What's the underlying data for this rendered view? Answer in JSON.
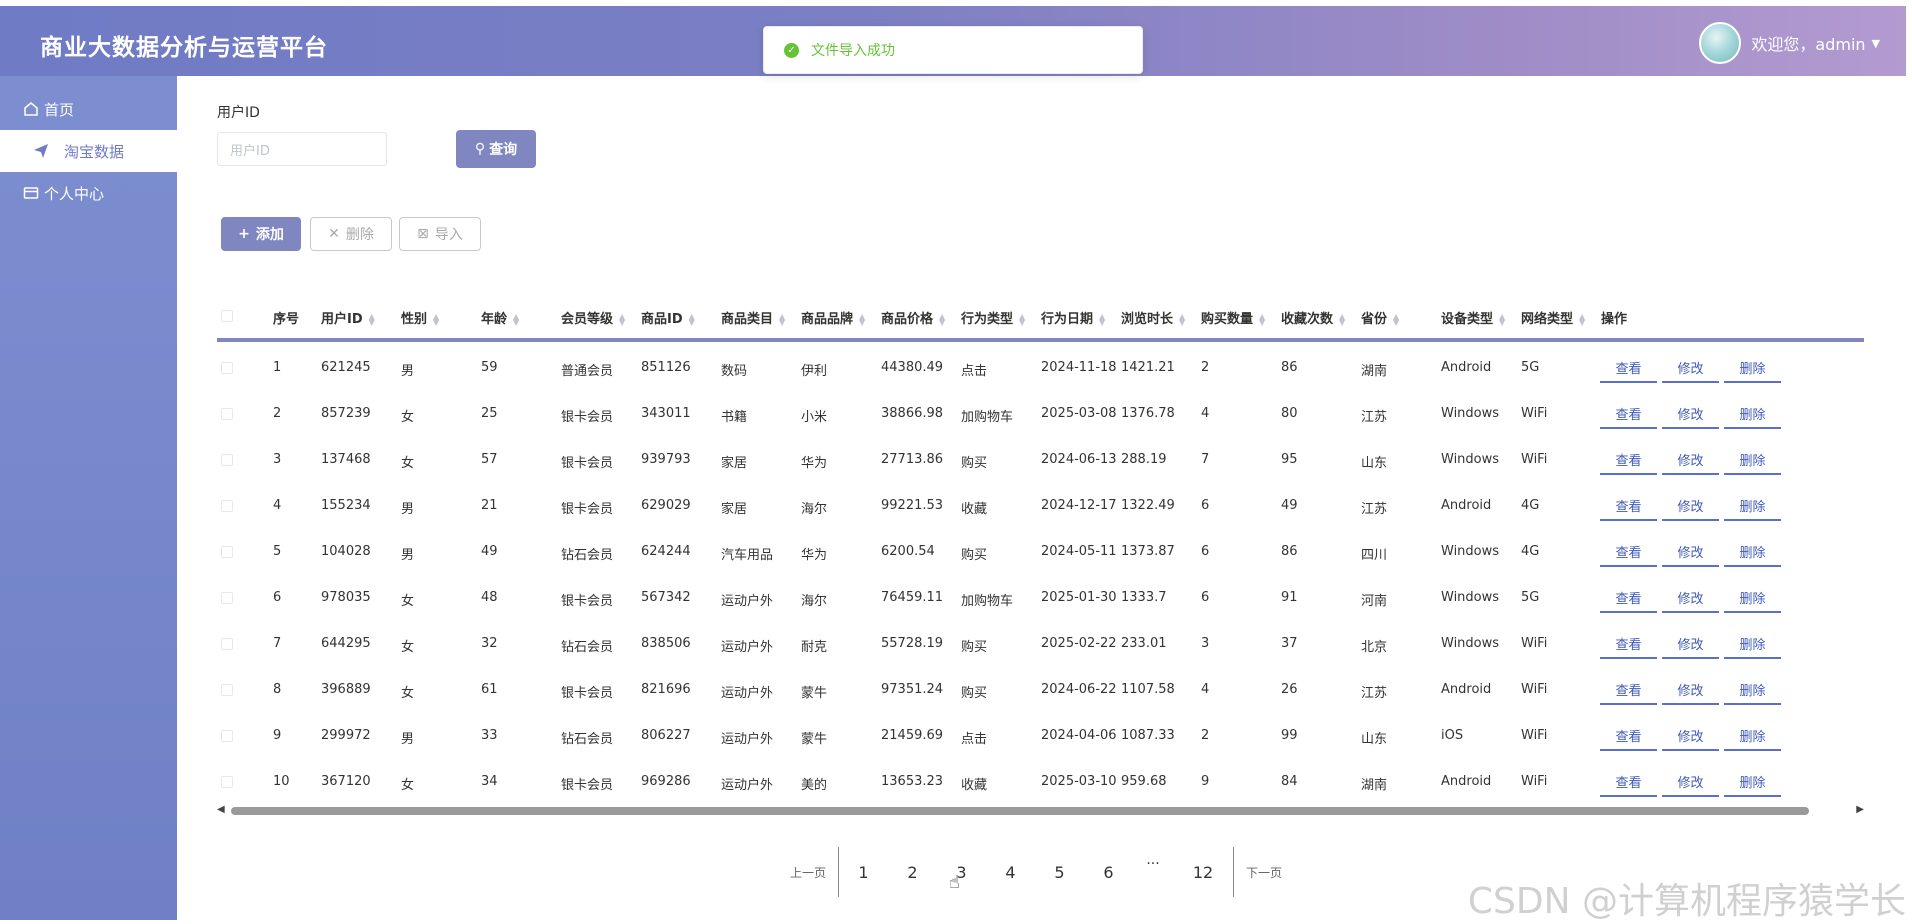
{
  "header": {
    "title": "商业大数据分析与运营平台",
    "welcome": "欢迎您，admin"
  },
  "toast": {
    "text": "文件导入成功"
  },
  "sidebar": {
    "items": [
      {
        "label": "首页"
      },
      {
        "label": "淘宝数据"
      },
      {
        "label": "个人中心"
      }
    ]
  },
  "search": {
    "label": "用户ID",
    "placeholder": "用户ID",
    "button": "查询"
  },
  "toolbar": {
    "add": "添加",
    "delete": "删除",
    "import": "导入"
  },
  "table": {
    "headers": [
      "序号",
      "用户ID",
      "性别",
      "年龄",
      "会员等级",
      "商品ID",
      "商品类目",
      "商品品牌",
      "商品价格",
      "行为类型",
      "行为日期",
      "浏览时长",
      "购买数量",
      "收藏次数",
      "省份",
      "设备类型",
      "网络类型",
      "操作"
    ],
    "actions": [
      "查看",
      "修改",
      "删除"
    ],
    "rows": [
      [
        "1",
        "621245",
        "男",
        "59",
        "普通会员",
        "851126",
        "数码",
        "伊利",
        "44380.49",
        "点击",
        "2024-11-18",
        "1421.21",
        "2",
        "86",
        "湖南",
        "Android",
        "5G"
      ],
      [
        "2",
        "857239",
        "女",
        "25",
        "银卡会员",
        "343011",
        "书籍",
        "小米",
        "38866.98",
        "加购物车",
        "2025-03-08",
        "1376.78",
        "4",
        "80",
        "江苏",
        "Windows",
        "WiFi"
      ],
      [
        "3",
        "137468",
        "女",
        "57",
        "银卡会员",
        "939793",
        "家居",
        "华为",
        "27713.86",
        "购买",
        "2024-06-13",
        "288.19",
        "7",
        "95",
        "山东",
        "Windows",
        "WiFi"
      ],
      [
        "4",
        "155234",
        "男",
        "21",
        "银卡会员",
        "629029",
        "家居",
        "海尔",
        "99221.53",
        "收藏",
        "2024-12-17",
        "1322.49",
        "6",
        "49",
        "江苏",
        "Android",
        "4G"
      ],
      [
        "5",
        "104028",
        "男",
        "49",
        "钻石会员",
        "624244",
        "汽车用品",
        "华为",
        "6200.54",
        "购买",
        "2024-05-11",
        "1373.87",
        "6",
        "86",
        "四川",
        "Windows",
        "4G"
      ],
      [
        "6",
        "978035",
        "女",
        "48",
        "银卡会员",
        "567342",
        "运动户外",
        "海尔",
        "76459.11",
        "加购物车",
        "2025-01-30",
        "1333.7",
        "6",
        "91",
        "河南",
        "Windows",
        "5G"
      ],
      [
        "7",
        "644295",
        "女",
        "32",
        "钻石会员",
        "838506",
        "运动户外",
        "耐克",
        "55728.19",
        "购买",
        "2025-02-22",
        "233.01",
        "3",
        "37",
        "北京",
        "Windows",
        "WiFi"
      ],
      [
        "8",
        "396889",
        "女",
        "61",
        "银卡会员",
        "821696",
        "运动户外",
        "蒙牛",
        "97351.24",
        "购买",
        "2024-06-22",
        "1107.58",
        "4",
        "26",
        "江苏",
        "Android",
        "WiFi"
      ],
      [
        "9",
        "299972",
        "男",
        "33",
        "钻石会员",
        "806227",
        "运动户外",
        "蒙牛",
        "21459.69",
        "点击",
        "2024-04-06",
        "1087.33",
        "2",
        "99",
        "山东",
        "iOS",
        "WiFi"
      ],
      [
        "10",
        "367120",
        "女",
        "34",
        "银卡会员",
        "969286",
        "运动户外",
        "美的",
        "13653.23",
        "收藏",
        "2025-03-10",
        "959.68",
        "9",
        "84",
        "湖南",
        "Android",
        "WiFi"
      ]
    ]
  },
  "pagination": {
    "prev": "上一页",
    "next": "下一页",
    "pages": [
      "1",
      "2",
      "3",
      "4",
      "5",
      "6"
    ],
    "ellipsis": "···",
    "last": "12"
  },
  "watermark": "CSDN @计算机程序猿学长"
}
